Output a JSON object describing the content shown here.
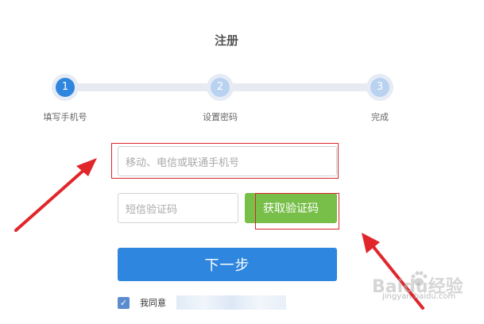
{
  "page": {
    "title": "注册"
  },
  "steps": [
    {
      "number": "1",
      "label": "填写手机号",
      "state": "active"
    },
    {
      "number": "2",
      "label": "设置密码",
      "state": "inactive"
    },
    {
      "number": "3",
      "label": "完成",
      "state": "inactive"
    }
  ],
  "form": {
    "phone_placeholder": "移动、电信或联通手机号",
    "code_placeholder": "短信验证码",
    "get_code_label": "获取验证码",
    "next_label": "下一步",
    "agree_text": "我同意",
    "agree_checked": true
  },
  "colors": {
    "accent": "#2e86de",
    "get_code_bg": "#78bf4a",
    "annotation_red": "#e0262b"
  },
  "watermark": {
    "main": "Baidu经验",
    "sub": "jingyan.baidu.com"
  }
}
